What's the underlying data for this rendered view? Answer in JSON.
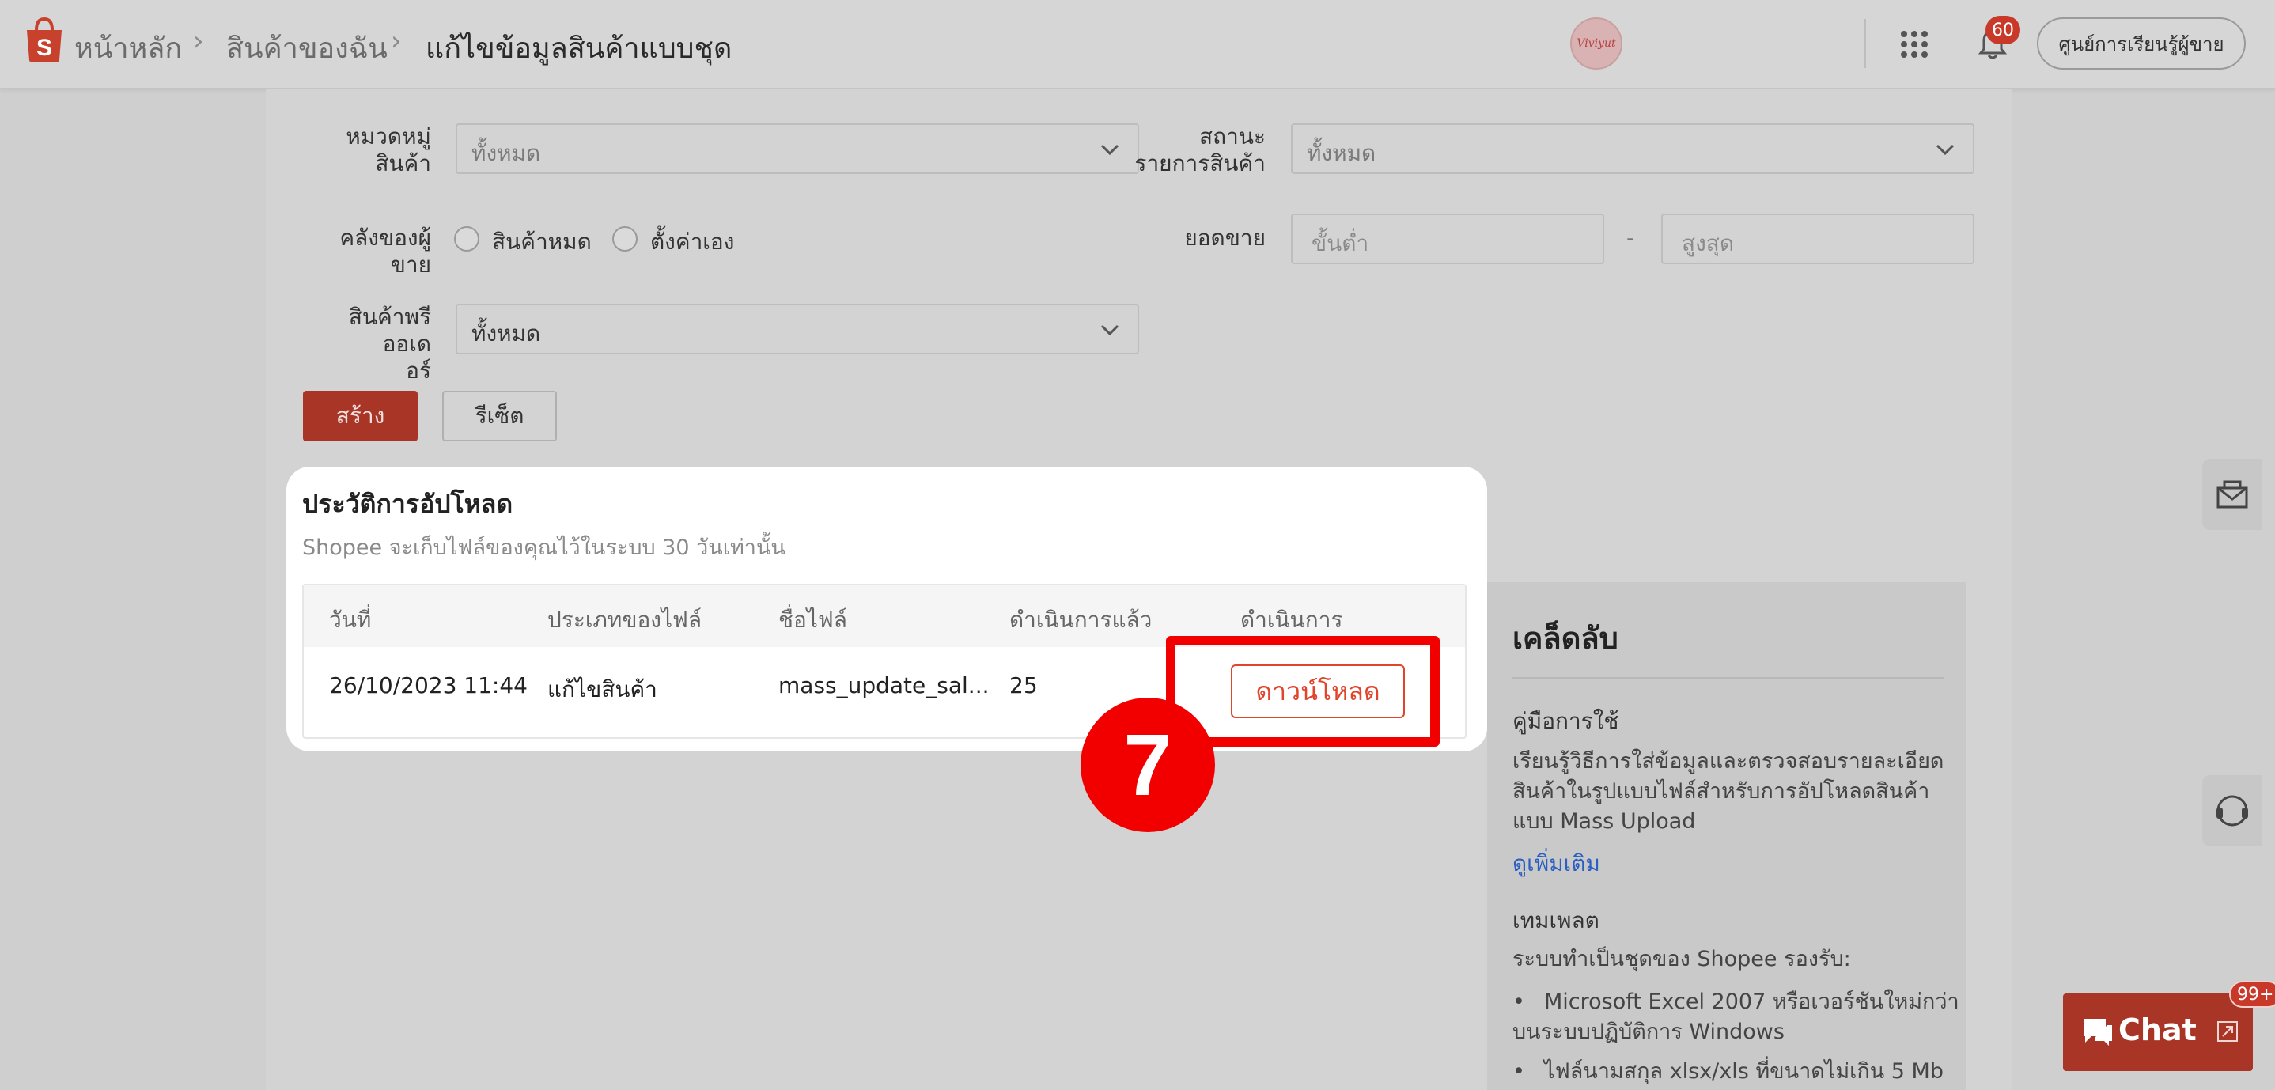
{
  "header": {
    "breadcrumbs": [
      "หน้าหลัก",
      "สินค้าของฉัน",
      "แก้ไขข้อมูลสินค้าแบบชุด"
    ],
    "avatar_text": "Viviyut",
    "notification_count": "60",
    "learn_button": "ศูนย์การเรียนรู้ผู้ขาย"
  },
  "filters": {
    "category_label_1": "หมวดหมู่",
    "category_label_2": "สินค้า",
    "category_value": "ทั้งหมด",
    "status_label_1": "สถานะ",
    "status_label_2": "รายการสินค้า",
    "status_value": "ทั้งหมด",
    "stock_label": "คลังของผู้ขาย",
    "stock_option_1": "สินค้าหมด",
    "stock_option_2": "ตั้งค่าเอง",
    "sales_label": "ยอดขาย",
    "sales_min_placeholder": "ขั้นต่ำ",
    "sales_separator": "-",
    "sales_max_placeholder": "สูงสุด",
    "preorder_label_1": "สินค้าพรีออเด",
    "preorder_label_2": "อร์",
    "preorder_value": "ทั้งหมด",
    "create_button": "สร้าง",
    "reset_button": "รีเซ็ต"
  },
  "history": {
    "title": "ประวัติการอัปโหลด",
    "subtitle": "Shopee จะเก็บไฟล์ของคุณไว้ในระบบ 30 วันเท่านั้น",
    "columns": [
      "วันที่",
      "ประเภทของไฟล์",
      "ชื่อไฟล์",
      "ดำเนินการแล้ว",
      "ดำเนินการ"
    ],
    "rows": [
      {
        "date": "26/10/2023 11:44",
        "type": "แก้ไขสินค้า",
        "filename": "mass_update_sal...",
        "processed": "25",
        "action": "ดาวน์โหลด"
      }
    ]
  },
  "annotation": {
    "step_number": "7"
  },
  "tips": {
    "title": "เคล็ดลับ",
    "guide_heading": "คู่มือการใช้",
    "guide_text_1": "เรียนรู้วิธีการใส่ข้อมูลและตรวจสอบรายละเอียด",
    "guide_text_2": "สินค้าในรูปแบบไฟล์สำหรับการอัปโหลดสินค้า",
    "guide_text_3": "แบบ Mass Upload",
    "more_link": "ดูเพิ่มเติม",
    "template_heading": "เทมเพลต",
    "template_text": "ระบบทำเป็นชุดของ Shopee รองรับ:",
    "bullet_1a": "Microsoft Excel 2007 หรือเวอร์ชันใหม่กว่า",
    "bullet_1b": "บนระบบปฏิบัติการ Windows",
    "bullet_2": "ไฟล์นามสกุล xlsx/xls ที่ขนาดไม่เกิน 5 Mb"
  },
  "chat": {
    "label": "Chat",
    "badge": "99+"
  },
  "colors": {
    "brand": "#ee4d2d",
    "highlight": "#f20000",
    "link": "#2a5fc1"
  }
}
